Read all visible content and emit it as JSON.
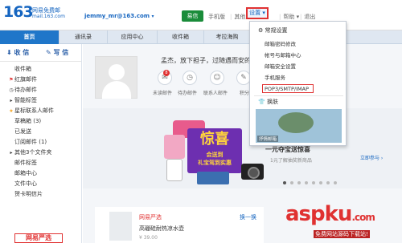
{
  "header": {
    "logo_number": "163",
    "logo_brand": "网易免费邮",
    "logo_domain": "mail.163.com",
    "account": "jemmy_mr@163.com",
    "account_caret": "▾",
    "green_button": "易信",
    "nav": [
      "手机版",
      "其他产品 ▾",
      "帮助 ▾",
      "退出"
    ],
    "settings_label": "设置 ▾"
  },
  "tabs": [
    "首页",
    "通讯录",
    "应用中心",
    "收件箱",
    "考拉海购"
  ],
  "sidebar": {
    "receive_label": "收 信",
    "write_label": "写 信",
    "folders": [
      {
        "icon": "",
        "label": "收件箱"
      },
      {
        "icon": "⚑",
        "label": "红旗邮件"
      },
      {
        "icon": "◷",
        "label": "待办邮件"
      },
      {
        "icon": "▸",
        "label": "智能标签"
      },
      {
        "icon": "★",
        "label": "星标联系人邮件"
      },
      {
        "icon": "",
        "label": "草稿箱 (3)"
      },
      {
        "icon": "",
        "label": "已发送"
      },
      {
        "icon": "",
        "label": "订阅邮件 (1)"
      },
      {
        "icon": "▸",
        "label": "其他3个文件夹"
      },
      {
        "icon": "",
        "label": "邮件标签"
      },
      {
        "icon": "",
        "label": "邮箱中心"
      },
      {
        "icon": "",
        "label": "文件中心"
      },
      {
        "icon": "",
        "label": "贺卡明信片"
      }
    ],
    "promo_label": "网易严选"
  },
  "main": {
    "greeting": "孟杰，放下担子，过随遇而安的生",
    "quick_actions": [
      {
        "icon": "✉",
        "label": "未读邮件",
        "badge": "8"
      },
      {
        "icon": "◷",
        "label": "待办邮件"
      },
      {
        "icon": "☺",
        "label": "联系人邮件"
      },
      {
        "icon": "✎",
        "label": "积分"
      }
    ],
    "banner_title": "惊喜",
    "banner_sub": "会送到",
    "banner_sub2": "礼宝驾到实惠",
    "slogan": "一元夺宝送惊喜",
    "slogan_sub": "1元了解抽奖新商品",
    "slogan_button": "立即参与 ›",
    "carousel_dots": 8,
    "carousel_active": 0,
    "bottom_card": {
      "title": "网易严选",
      "swap": "换一换",
      "item": "高硼硅耐热凉水壶",
      "price": "¥ 39.00"
    }
  },
  "settings_menu": {
    "items": [
      {
        "label": "常规设置",
        "icon": "⚙",
        "head": true
      },
      {
        "label": "邮箱密码修改",
        "head": false
      },
      {
        "label": "帐号与邮箱中心",
        "head": false
      },
      {
        "label": "邮箱安全设置",
        "head": false
      },
      {
        "label": "手机服务",
        "head": false
      },
      {
        "label": "POP3/SMTP/IMAP",
        "head": false,
        "highlighted": true
      },
      {
        "label": "换肤",
        "icon": "👕",
        "head": true
      }
    ],
    "skin_label": "抒情邮箱"
  },
  "watermark": {
    "main": "aspku",
    "suffix": ".com",
    "sub": "免费网站源码下载站!"
  },
  "colors": {
    "accent": "#1f76c9",
    "highlight": "#e03131",
    "green": "#1a8c3a"
  }
}
